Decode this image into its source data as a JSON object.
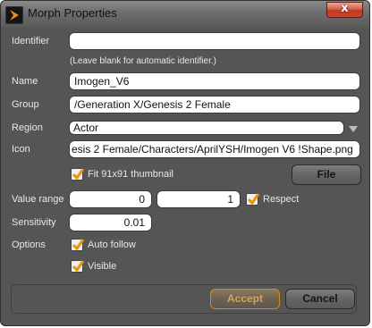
{
  "window": {
    "title": "Morph Properties",
    "close_label": "x"
  },
  "form": {
    "identifier": {
      "label": "Identifier",
      "value": "",
      "hint": "(Leave blank for automatic identifier.)"
    },
    "name": {
      "label": "Name",
      "value": "Imogen_V6"
    },
    "group": {
      "label": "Group",
      "value": "/Generation X/Genesis 2 Female"
    },
    "region": {
      "label": "Region",
      "value": "Actor"
    },
    "icon": {
      "label": "Icon",
      "value": "esis 2 Female/Characters/AprilYSH/Imogen V6 !Shape.png",
      "fit_label": "Fit 91x91 thumbnail",
      "fit_checked": true,
      "file_button": "File"
    },
    "value_range": {
      "label": "Value range",
      "min": "0",
      "max": "1",
      "respect_label": "Respect",
      "respect_checked": true
    },
    "sensitivity": {
      "label": "Sensitivity",
      "value": "0.01"
    },
    "options": {
      "label": "Options",
      "auto_follow_label": "Auto follow",
      "auto_follow_checked": true,
      "visible_label": "Visible",
      "visible_checked": true
    }
  },
  "buttons": {
    "accept": "Accept",
    "cancel": "Cancel"
  },
  "colors": {
    "accent": "#e8940e",
    "panel": "#555555",
    "close": "#c8432a"
  }
}
